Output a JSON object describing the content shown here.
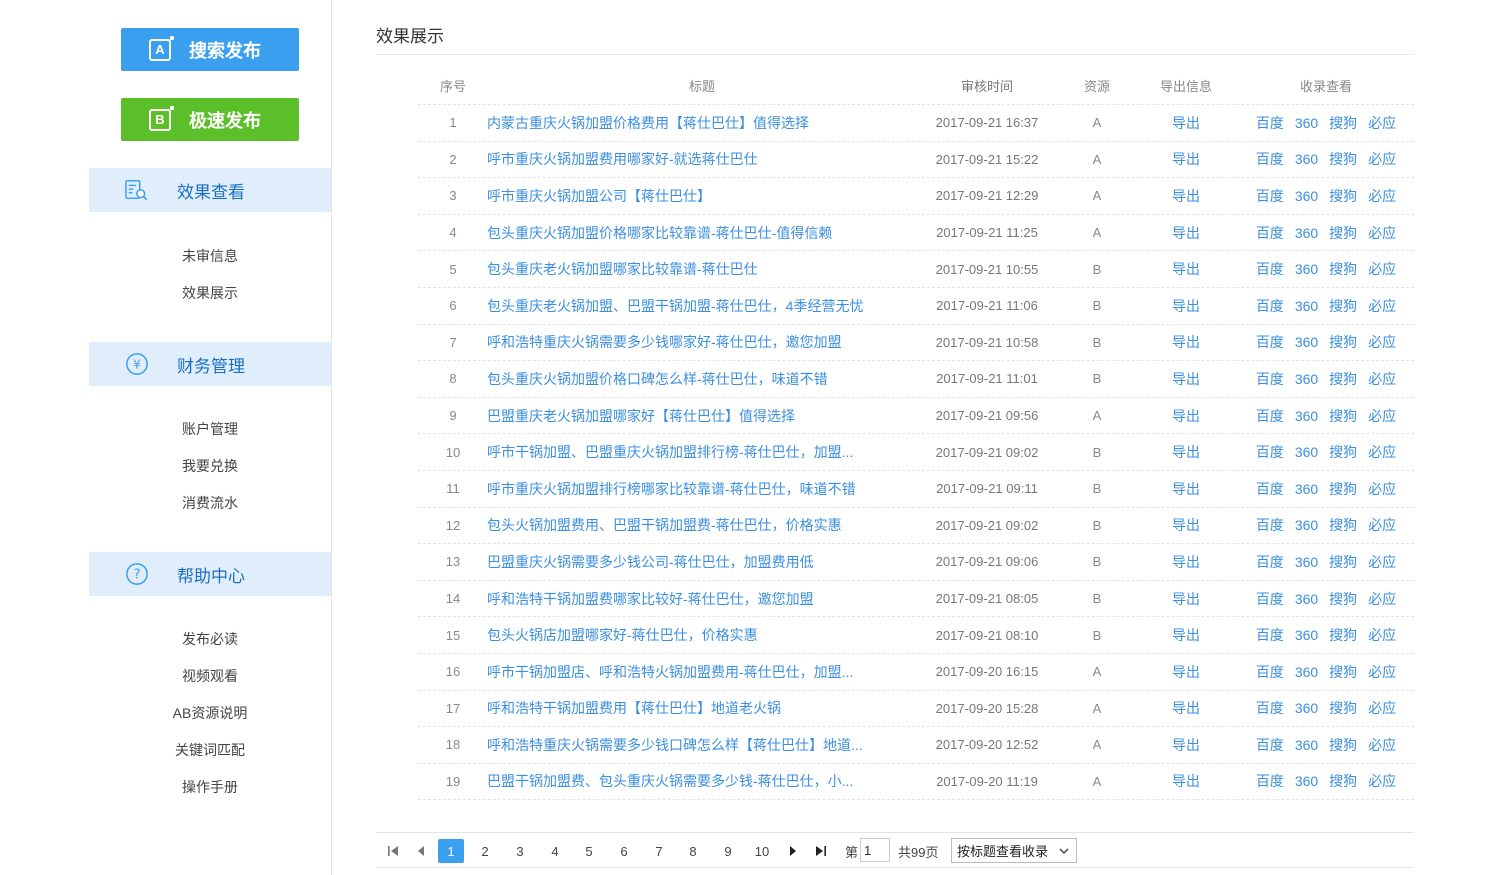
{
  "sidebar": {
    "publish_buttons": [
      {
        "label": "搜索发布",
        "icon_letter": "A",
        "color": "#3b9ff0"
      },
      {
        "label": "极速发布",
        "icon_letter": "B",
        "color": "#5cbf2a"
      }
    ],
    "sections": [
      {
        "title": "效果查看",
        "icon": "search-document-icon",
        "items": [
          "未审信息",
          "效果展示"
        ]
      },
      {
        "title": "财务管理",
        "icon": "yuan-icon",
        "items": [
          "账户管理",
          "我要兑换",
          "消费流水"
        ]
      },
      {
        "title": "帮助中心",
        "icon": "question-icon",
        "items": [
          "发布必读",
          "视频观看",
          "AB资源说明",
          "关键词匹配",
          "操作手册"
        ]
      }
    ]
  },
  "main": {
    "title": "效果展示",
    "columns": {
      "index": "序号",
      "title": "标题",
      "time": "审核时间",
      "resource": "资源",
      "export": "导出信息",
      "index_check": "收录查看"
    },
    "export_label": "导出",
    "engines": [
      "百度",
      "360",
      "搜狗",
      "必应"
    ],
    "rows": [
      {
        "idx": "1",
        "title": "内蒙古重庆火锅加盟价格费用【蒋仕巴仕】值得选择",
        "time": "2017-09-21 16:37",
        "res": "A"
      },
      {
        "idx": "2",
        "title": "呼市重庆火锅加盟费用哪家好-就选蒋仕巴仕",
        "time": "2017-09-21 15:22",
        "res": "A"
      },
      {
        "idx": "3",
        "title": "呼市重庆火锅加盟公司【蒋仕巴仕】",
        "time": "2017-09-21 12:29",
        "res": "A"
      },
      {
        "idx": "4",
        "title": "包头重庆火锅加盟价格哪家比较靠谱-蒋仕巴仕-值得信赖",
        "time": "2017-09-21 11:25",
        "res": "A"
      },
      {
        "idx": "5",
        "title": "包头重庆老火锅加盟哪家比较靠谱-蒋仕巴仕",
        "time": "2017-09-21 10:55",
        "res": "B"
      },
      {
        "idx": "6",
        "title": "包头重庆老火锅加盟、巴盟干锅加盟-蒋仕巴仕，4季经营无忧",
        "time": "2017-09-21 11:06",
        "res": "B"
      },
      {
        "idx": "7",
        "title": "呼和浩特重庆火锅需要多少钱哪家好-蒋仕巴仕，邀您加盟",
        "time": "2017-09-21 10:58",
        "res": "B"
      },
      {
        "idx": "8",
        "title": "包头重庆火锅加盟价格口碑怎么样-蒋仕巴仕，味道不错",
        "time": "2017-09-21 11:01",
        "res": "B"
      },
      {
        "idx": "9",
        "title": "巴盟重庆老火锅加盟哪家好【蒋仕巴仕】值得选择",
        "time": "2017-09-21 09:56",
        "res": "A"
      },
      {
        "idx": "10",
        "title": "呼市干锅加盟、巴盟重庆火锅加盟排行榜-蒋仕巴仕，加盟...",
        "time": "2017-09-21 09:02",
        "res": "B"
      },
      {
        "idx": "11",
        "title": "呼市重庆火锅加盟排行榜哪家比较靠谱-蒋仕巴仕，味道不错",
        "time": "2017-09-21 09:11",
        "res": "B"
      },
      {
        "idx": "12",
        "title": "包头火锅加盟费用、巴盟干锅加盟费-蒋仕巴仕，价格实惠",
        "time": "2017-09-21 09:02",
        "res": "B"
      },
      {
        "idx": "13",
        "title": "巴盟重庆火锅需要多少钱公司-蒋仕巴仕，加盟费用低",
        "time": "2017-09-21 09:06",
        "res": "B"
      },
      {
        "idx": "14",
        "title": "呼和浩特干锅加盟费哪家比较好-蒋仕巴仕，邀您加盟",
        "time": "2017-09-21 08:05",
        "res": "B"
      },
      {
        "idx": "15",
        "title": "包头火锅店加盟哪家好-蒋仕巴仕，价格实惠",
        "time": "2017-09-21 08:10",
        "res": "B"
      },
      {
        "idx": "16",
        "title": "呼市干锅加盟店、呼和浩特火锅加盟费用-蒋仕巴仕，加盟...",
        "time": "2017-09-20 16:15",
        "res": "A"
      },
      {
        "idx": "17",
        "title": "呼和浩特干锅加盟费用【蒋仕巴仕】地道老火锅",
        "time": "2017-09-20 15:28",
        "res": "A"
      },
      {
        "idx": "18",
        "title": "呼和浩特重庆火锅需要多少钱口碑怎么样【蒋仕巴仕】地道...",
        "time": "2017-09-20 12:52",
        "res": "A"
      },
      {
        "idx": "19",
        "title": "巴盟干锅加盟费、包头重庆火锅需要多少钱-蒋仕巴仕，小...",
        "time": "2017-09-20 11:19",
        "res": "A"
      }
    ]
  },
  "pager": {
    "pages": [
      "1",
      "2",
      "3",
      "4",
      "5",
      "6",
      "7",
      "8",
      "9",
      "10"
    ],
    "current": "1",
    "goto_prefix": "第",
    "goto_value": "1",
    "total_text": "共99页",
    "select_value": "按标题查看收录"
  }
}
